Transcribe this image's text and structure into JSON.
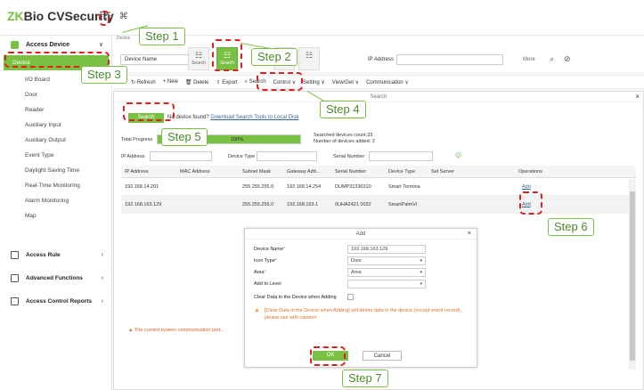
{
  "app": {
    "logo_prefix": "ZK",
    "logo_main": "Bio CVSecurity"
  },
  "header": {
    "icon_grid": "☷",
    "icon_cross": "⌘"
  },
  "sidebar": {
    "module": "Access Device",
    "items": [
      "Device",
      "I/O Board",
      "Door",
      "Reader",
      "Auxiliary Input",
      "Auxiliary Output",
      "Event Type",
      "Daylight Saving Time",
      "Real-Time Monitoring",
      "Alarm Monitoring",
      "Map"
    ],
    "groups": [
      "Access Rule",
      "Advanced Functions",
      "Access Control Reports"
    ]
  },
  "main": {
    "tab": "Device",
    "filter": {
      "device_name_label": "Device Name",
      "ip_label": "IP Address",
      "more_label": "More",
      "search_icon": "⌕",
      "clear_icon": "⊘"
    },
    "square_buttons": [
      {
        "glyph": "☷",
        "label": "Search"
      },
      {
        "glyph": "☷",
        "label": "Search"
      },
      {
        "glyph": "☷",
        "label": ""
      },
      {
        "glyph": "☷",
        "label": ""
      }
    ],
    "toolbar": [
      "↻ Refresh",
      "+ New",
      "🗑 Delete",
      "⇧ Export",
      "⌕ Search",
      "Control ∨",
      "Setting ∨",
      "View/Get ∨",
      "Communication ∨"
    ]
  },
  "search_panel": {
    "title": "Search",
    "search_button": "Search",
    "note_prefix": "No device found?",
    "note_link": "Download Search Tools to Local Disk",
    "progress_label": "Total Progress",
    "progress_text": "100%",
    "progress_value": 1.0,
    "found_count": "Searched devices count:33",
    "added_count": "Number of devices added: 2",
    "ip_label": "IP Address",
    "type_label": "Device Type",
    "serial_label": "Serial Number",
    "refresh_icon": "◎",
    "columns": [
      "IP Address",
      "MAC Address",
      "Subnet Mask",
      "Gateway Add...",
      "Serial Number",
      "Device Type",
      "Set Server",
      "Operations"
    ],
    "rows": [
      [
        "192.168.14.201",
        "",
        "255.255.255.0",
        "192.168.14.254",
        "DUMP31336310",
        "Smart Termina",
        "",
        "Add"
      ],
      [
        "192.168.163.129",
        "",
        "255.255.255.0",
        "192.168.163.1",
        "0UHA2421 0032",
        "SmartPalmVi",
        "",
        "Add"
      ]
    ],
    "warning": "The current system communication port...",
    "close": "×"
  },
  "add_dialog": {
    "title": "Add",
    "close": "×",
    "fields": [
      {
        "label": "Device Name",
        "required": true,
        "value": "192.168.163.129",
        "dropdown": false
      },
      {
        "label": "Icon Type",
        "required": true,
        "value": "Door",
        "dropdown": true
      },
      {
        "label": "Area",
        "required": true,
        "value": "Area",
        "dropdown": true
      },
      {
        "label": "Add to Level",
        "required": false,
        "value": "",
        "dropdown": true
      }
    ],
    "clear_label": "Clear Data in the Device when Adding",
    "warning": "[Clear Data in the Device when Adding] will delete data in the device (except event record), please use with caution!",
    "ok": "OK",
    "cancel": "Cancel"
  },
  "steps": [
    "Step 1",
    "Step 2",
    "Step 3",
    "Step 4",
    "Step 5",
    "Step 6",
    "Step 7"
  ]
}
